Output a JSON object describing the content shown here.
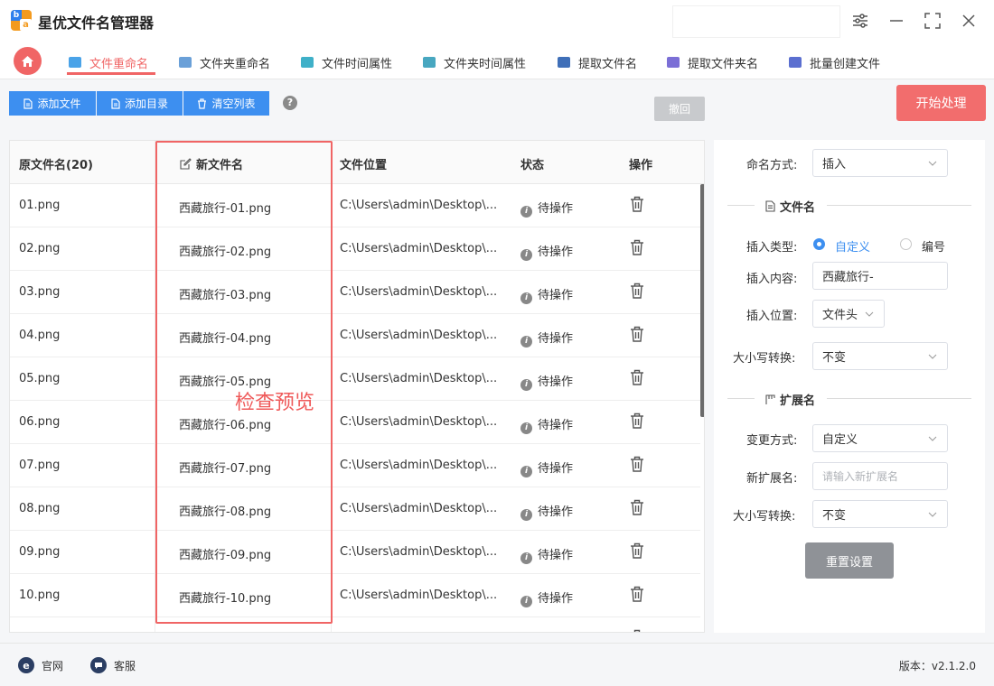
{
  "app": {
    "title": "星优文件名管理器"
  },
  "tabs": [
    {
      "label": "文件重命名",
      "color": "#4aa3e8"
    },
    {
      "label": "文件夹重命名",
      "color": "#6aa0d8"
    },
    {
      "label": "文件时间属性",
      "color": "#3fb0c8"
    },
    {
      "label": "文件夹时间属性",
      "color": "#48a7c0"
    },
    {
      "label": "提取文件名",
      "color": "#3f6fb8"
    },
    {
      "label": "提取文件夹名",
      "color": "#7b6fd6"
    },
    {
      "label": "批量创建文件",
      "color": "#5b6fd0"
    }
  ],
  "toolbar": {
    "add_file": "添加文件",
    "add_dir": "添加目录",
    "clear_list": "清空列表",
    "help": "?",
    "undo": "撤回",
    "start": "开始处理"
  },
  "table": {
    "headers": {
      "orig": "原文件名(20)",
      "new": "新文件名",
      "location": "文件位置",
      "status": "状态",
      "action": "操作"
    },
    "rows": [
      {
        "orig": "01.png",
        "new": "西藏旅行-01.png",
        "location": "C:\\Users\\admin\\Desktop\\...",
        "status": "待操作"
      },
      {
        "orig": "02.png",
        "new": "西藏旅行-02.png",
        "location": "C:\\Users\\admin\\Desktop\\...",
        "status": "待操作"
      },
      {
        "orig": "03.png",
        "new": "西藏旅行-03.png",
        "location": "C:\\Users\\admin\\Desktop\\...",
        "status": "待操作"
      },
      {
        "orig": "04.png",
        "new": "西藏旅行-04.png",
        "location": "C:\\Users\\admin\\Desktop\\...",
        "status": "待操作"
      },
      {
        "orig": "05.png",
        "new": "西藏旅行-05.png",
        "location": "C:\\Users\\admin\\Desktop\\...",
        "status": "待操作"
      },
      {
        "orig": "06.png",
        "new": "西藏旅行-06.png",
        "location": "C:\\Users\\admin\\Desktop\\...",
        "status": "待操作"
      },
      {
        "orig": "07.png",
        "new": "西藏旅行-07.png",
        "location": "C:\\Users\\admin\\Desktop\\...",
        "status": "待操作"
      },
      {
        "orig": "08.png",
        "new": "西藏旅行-08.png",
        "location": "C:\\Users\\admin\\Desktop\\...",
        "status": "待操作"
      },
      {
        "orig": "09.png",
        "new": "西藏旅行-09.png",
        "location": "C:\\Users\\admin\\Desktop\\...",
        "status": "待操作"
      },
      {
        "orig": "10.png",
        "new": "西藏旅行-10.png",
        "location": "C:\\Users\\admin\\Desktop\\...",
        "status": "待操作"
      }
    ]
  },
  "annotation": {
    "preview": "检查预览"
  },
  "settings": {
    "naming_method_label": "命名方式:",
    "naming_method_value": "插入",
    "filename_section": "文件名",
    "insert_type_label": "插入类型:",
    "insert_type_custom": "自定义",
    "insert_type_number": "编号",
    "insert_content_label": "插入内容:",
    "insert_content_value": "西藏旅行-",
    "insert_position_label": "插入位置:",
    "insert_position_value": "文件头",
    "case_label": "大小写转换:",
    "case_value": "不变",
    "ext_section": "扩展名",
    "change_method_label": "变更方式:",
    "change_method_value": "自定义",
    "new_ext_label": "新扩展名:",
    "new_ext_placeholder": "请输入新扩展名",
    "ext_case_label": "大小写转换:",
    "ext_case_value": "不变",
    "reset": "重置设置"
  },
  "footer": {
    "website": "官网",
    "support": "客服",
    "version": "版本：v2.1.2.0"
  },
  "colors": {
    "accent_red": "#f06565",
    "primary_blue": "#3d8ff0"
  }
}
